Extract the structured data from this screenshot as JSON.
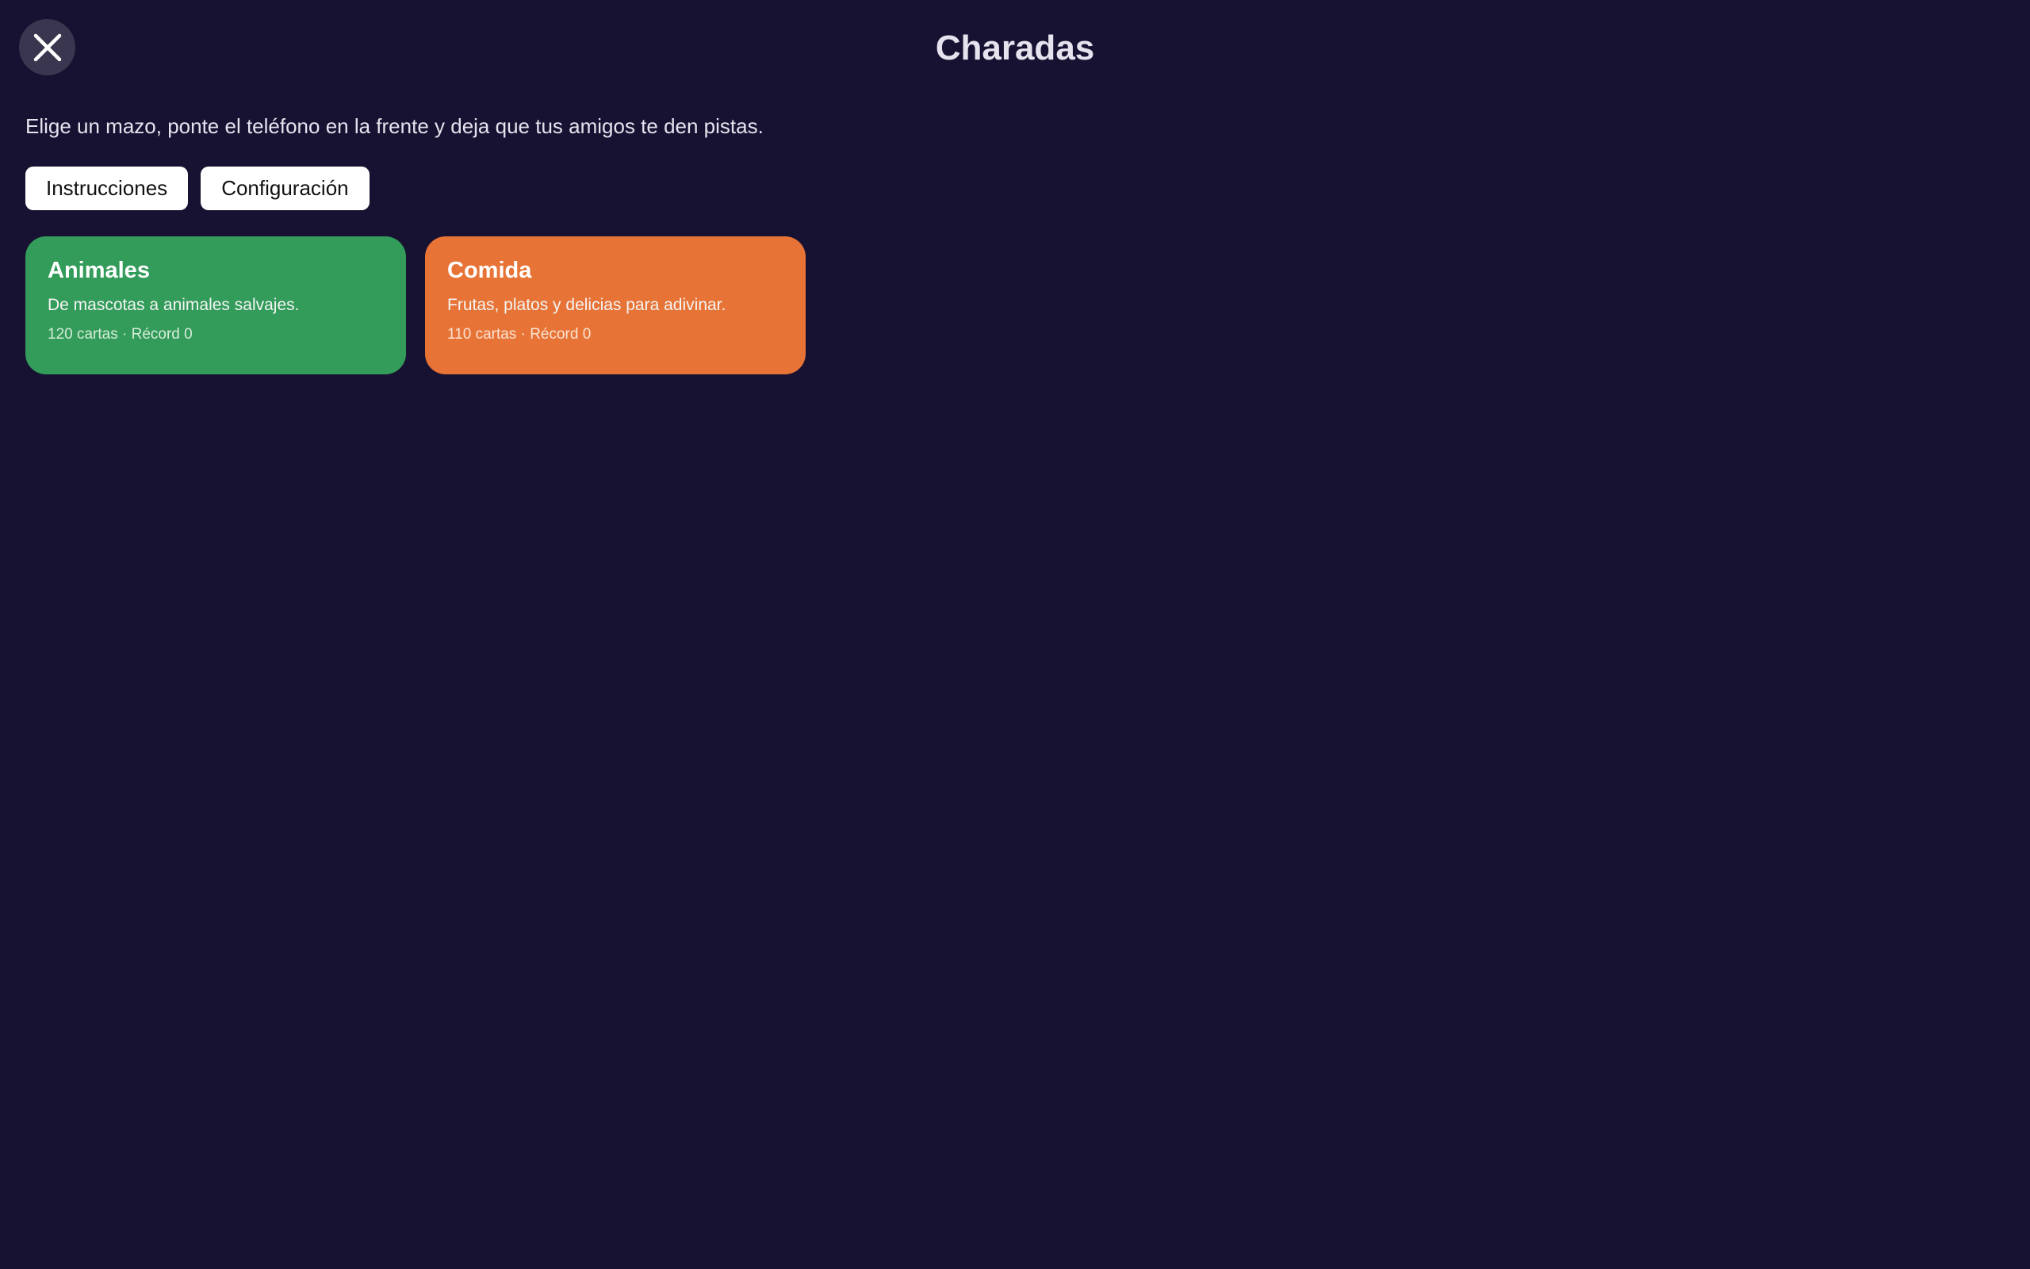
{
  "app": {
    "title": "Charadas",
    "subtitle": "Elige un mazo, ponte el teléfono en la frente y deja que tus amigos te den pistas."
  },
  "header": {
    "close_icon": "close-icon"
  },
  "buttons": {
    "instructions_label": "Instrucciones",
    "settings_label": "Configuración"
  },
  "decks": [
    {
      "title": "Animales",
      "description": "De mascotas a animales salvajes.",
      "meta": "120 cartas · Récord 0",
      "color": "#339c5a",
      "meta_color": "#d6ecd9"
    },
    {
      "title": "Comida",
      "description": "Frutas, platos y delicias para adivinar.",
      "meta": "110 cartas · Récord 0",
      "color": "#e77436",
      "meta_color": "#fbe2d2"
    }
  ],
  "colors": {
    "background": "#181232",
    "text": "#e6e2ee",
    "close_button": "#3a3650"
  }
}
